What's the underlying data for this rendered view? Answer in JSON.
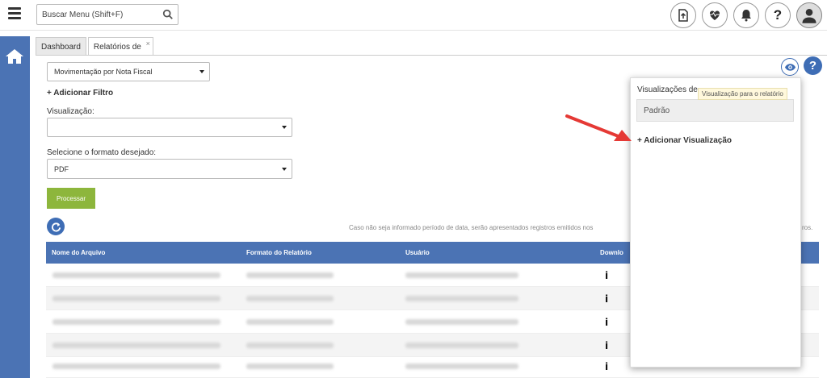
{
  "topbar": {
    "search_placeholder": "Buscar Menu  (Shift+F)",
    "icons": [
      "menu-icon",
      "search-icon",
      "upload-file-icon",
      "health-icon",
      "bell-icon",
      "help-icon",
      "user-icon"
    ],
    "help_label": "?"
  },
  "tabs": [
    {
      "label": "Dashboard"
    },
    {
      "label": "Relatórios de",
      "close": "×"
    }
  ],
  "form": {
    "report_select": "Movimentação por Nota Fiscal",
    "add_filter": "+ Adicionar Filtro",
    "visualization_label": "Visualização:",
    "visualization_value": "",
    "format_label": "Selecione o formato desejado:",
    "format_value": "PDF",
    "process_button": "Processar"
  },
  "notice": {
    "text": "Caso não seja informado período de data, serão apresentados registros emitidos nos",
    "tail": "ros."
  },
  "table": {
    "columns": [
      "Nome do Arquivo",
      "Formato do Relatório",
      "Usuário",
      "Downlo"
    ],
    "row_action": "i"
  },
  "panel": {
    "title": "Visualizações de",
    "tooltip": "Visualização para o relatório",
    "item": "Padrão",
    "add": "+ Adicionar Visualização",
    "help": "?"
  },
  "colors": {
    "primary": "#4b73b4",
    "process_button": "#8db63c",
    "annotation_arrow": "#e53935"
  }
}
